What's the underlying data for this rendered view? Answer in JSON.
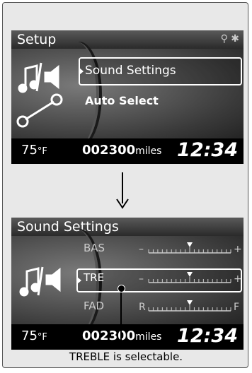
{
  "screen1": {
    "title": "Setup",
    "status_icons": "USB · Bluetooth",
    "menu": [
      {
        "label": "Sound Settings",
        "selected": true
      },
      {
        "label": "Auto Select",
        "selected": false
      }
    ],
    "temperature": "75",
    "temperature_unit": "°F",
    "odometer": "002300",
    "odometer_unit": "miles",
    "clock": "12:34"
  },
  "screen2": {
    "title": "Sound Settings",
    "rows": [
      {
        "label": "BAS",
        "left": "–",
        "right": "+",
        "level": 0.5,
        "selected": false
      },
      {
        "label": "TRE",
        "left": "–",
        "right": "+",
        "level": 0.5,
        "selected": true
      },
      {
        "label": "FAD",
        "left": "R",
        "right": "F",
        "level": 0.5,
        "selected": false
      }
    ],
    "temperature": "75",
    "temperature_unit": "°F",
    "odometer": "002300",
    "odometer_unit": "miles",
    "clock": "12:34"
  },
  "caption": "TREBLE is selectable."
}
